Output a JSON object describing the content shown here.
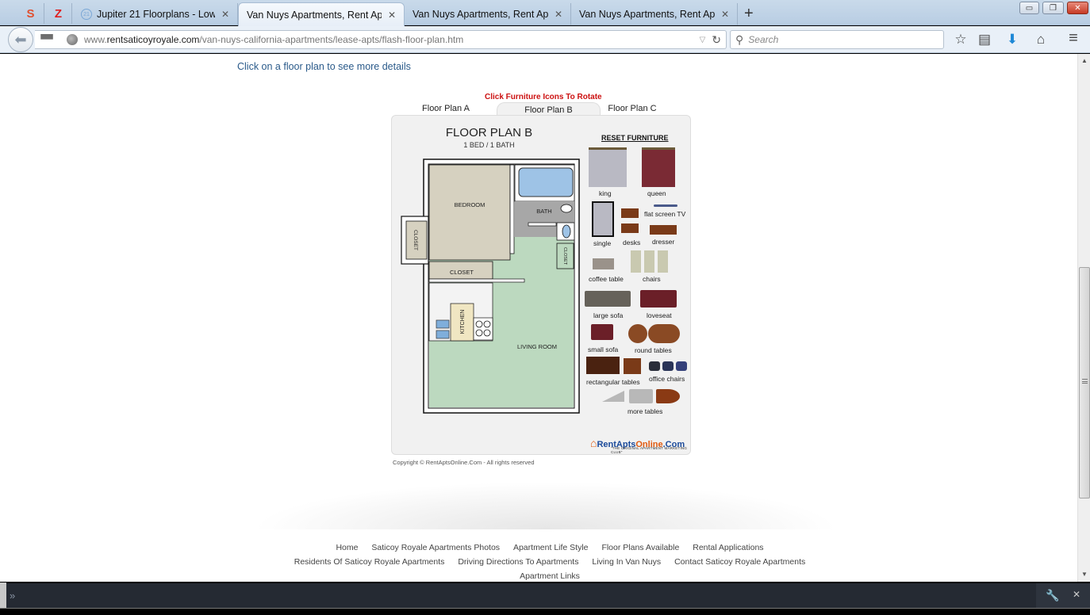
{
  "browser": {
    "pinned_tabs": [
      {
        "icon": "swirl-app-icon",
        "glyph": "S",
        "color": "#e05030"
      },
      {
        "icon": "ez-app-icon",
        "glyph": "Z",
        "color": "#e02020"
      }
    ],
    "tabs": [
      {
        "title": "Jupiter 21 Floorplans - Low...",
        "favicon": "21",
        "active": false
      },
      {
        "title": "Van Nuys Apartments, Rent Ap...",
        "active": true
      },
      {
        "title": "Van Nuys Apartments, Rent Ap...",
        "active": false
      },
      {
        "title": "Van Nuys Apartments, Rent Ap...",
        "active": false
      }
    ],
    "close_glyph": "✕",
    "new_tab_glyph": "+",
    "window_buttons": {
      "minimize": "▭",
      "restore": "❐",
      "close": "✕"
    },
    "url": {
      "prefix": "www.",
      "domain": "rentsaticoyroyale.com",
      "path": "/van-nuys-california-apartments/lease-apts/flash-floor-plan.htm"
    },
    "search_placeholder": "Search",
    "toolbar_icons": {
      "bookmark": "☆",
      "reading_list": "▤",
      "downloads": "⬇",
      "home": "⌂",
      "menu": "≡"
    }
  },
  "page": {
    "instructions": "Click on a floor plan to see more details",
    "rotate_hint": "Click Furniture Icons To Rotate",
    "floor_plan_tabs": [
      {
        "label": "Floor Plan A",
        "active": false
      },
      {
        "label": "Floor Plan B",
        "active": true
      },
      {
        "label": "Floor Plan C",
        "active": false
      }
    ],
    "plan_title": "FLOOR PLAN B",
    "plan_subtitle": "1 BED / 1 BATH",
    "reset_label": "RESET FURNITURE",
    "rooms": {
      "bedroom": "BEDROOM",
      "bath": "BATH",
      "closet_left": "CLOSET",
      "closet_right": "CLOSET",
      "closet_hall": "CLOSET",
      "kitchen": "KITCHEN",
      "living": "LIVING ROOM"
    },
    "furniture": [
      {
        "label": "king"
      },
      {
        "label": "queen"
      },
      {
        "label": "single"
      },
      {
        "label": "desks"
      },
      {
        "label": "flat screen  TV"
      },
      {
        "label": "dresser"
      },
      {
        "label": "coffee table"
      },
      {
        "label": "chairs"
      },
      {
        "label": "large sofa"
      },
      {
        "label": "loveseat"
      },
      {
        "label": "small sofa"
      },
      {
        "label": "round tables"
      },
      {
        "label": "rectangular tables"
      },
      {
        "label": "office chairs"
      },
      {
        "label": "more tables"
      }
    ],
    "logo": {
      "part1": "RentApts",
      "part2": "Online",
      "part3": ".Com",
      "tagline": "\"THE ORIGINAL APARTMENT MARKETING CLUB\""
    },
    "copyright": "Copyright © RentAptsOnline.Com - All rights reserved",
    "footer_links": [
      "Home",
      "Saticoy Royale Apartments Photos",
      "Apartment Life Style",
      "Floor Plans Available",
      "Rental Applications",
      "Residents Of Saticoy Royale Apartments",
      "Driving Directions To Apartments",
      "Living In Van Nuys",
      "Contact Saticoy Royale Apartments",
      "Apartment Links"
    ]
  },
  "devtools": {
    "prompt": "»",
    "settings_icon": "🔧",
    "close": "✕"
  },
  "colors": {
    "link_blue": "#2a5a8a",
    "hint_red": "#cc1111",
    "bedroom_floor": "#d6d1c0",
    "living_floor": "#bcd9bf",
    "bath_floor": "#a7a7a7",
    "tub_blue": "#9ec3e6",
    "queen_red": "#7a2a34",
    "wood_brown": "#7a3a18"
  }
}
